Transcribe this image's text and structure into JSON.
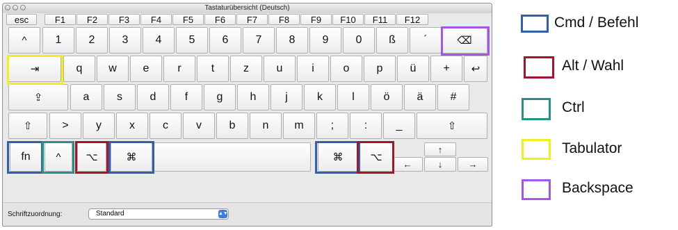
{
  "window": {
    "title": "Tastaturübersicht (Deutsch)"
  },
  "function_row": [
    "esc",
    "F1",
    "F2",
    "F3",
    "F4",
    "F5",
    "F6",
    "F7",
    "F8",
    "F9",
    "F10",
    "F11",
    "F12"
  ],
  "number_row": [
    "^",
    "1",
    "2",
    "3",
    "4",
    "5",
    "6",
    "7",
    "8",
    "9",
    "0",
    "ß",
    "´",
    "⌫"
  ],
  "qwertz_row": [
    "⇥",
    "q",
    "w",
    "e",
    "r",
    "t",
    "z",
    "u",
    "i",
    "o",
    "p",
    "ü",
    "+",
    "↩"
  ],
  "asdf_row": [
    "⇪",
    "a",
    "s",
    "d",
    "f",
    "g",
    "h",
    "j",
    "k",
    "l",
    "ö",
    "ä",
    "#"
  ],
  "yxcv_row": [
    "⇧",
    ">",
    "y",
    "x",
    "c",
    "v",
    "b",
    "n",
    "m",
    ";",
    ":",
    "_",
    "⇧"
  ],
  "modifier_row": {
    "fn": "fn",
    "ctrl": "^",
    "alt_left": "⌥",
    "cmd_left": "⌘",
    "space": "",
    "cmd_right": "⌘",
    "alt_right": "⌥"
  },
  "arrows": {
    "up": "↑",
    "down": "↓",
    "left": "←",
    "right": "→"
  },
  "bottom_bar": {
    "label": "Schriftzuordnung:",
    "select_value": "Standard"
  },
  "legend": [
    {
      "label": "Cmd / Befehl",
      "color": "#2f5fb3"
    },
    {
      "label": "Alt / Wahl",
      "color": "#a2152b"
    },
    {
      "label": "Ctrl",
      "color": "#2a8f88"
    },
    {
      "label": "Tabulator",
      "color": "#f1ef1c"
    },
    {
      "label": "Backspace",
      "color": "#a457e6"
    }
  ]
}
